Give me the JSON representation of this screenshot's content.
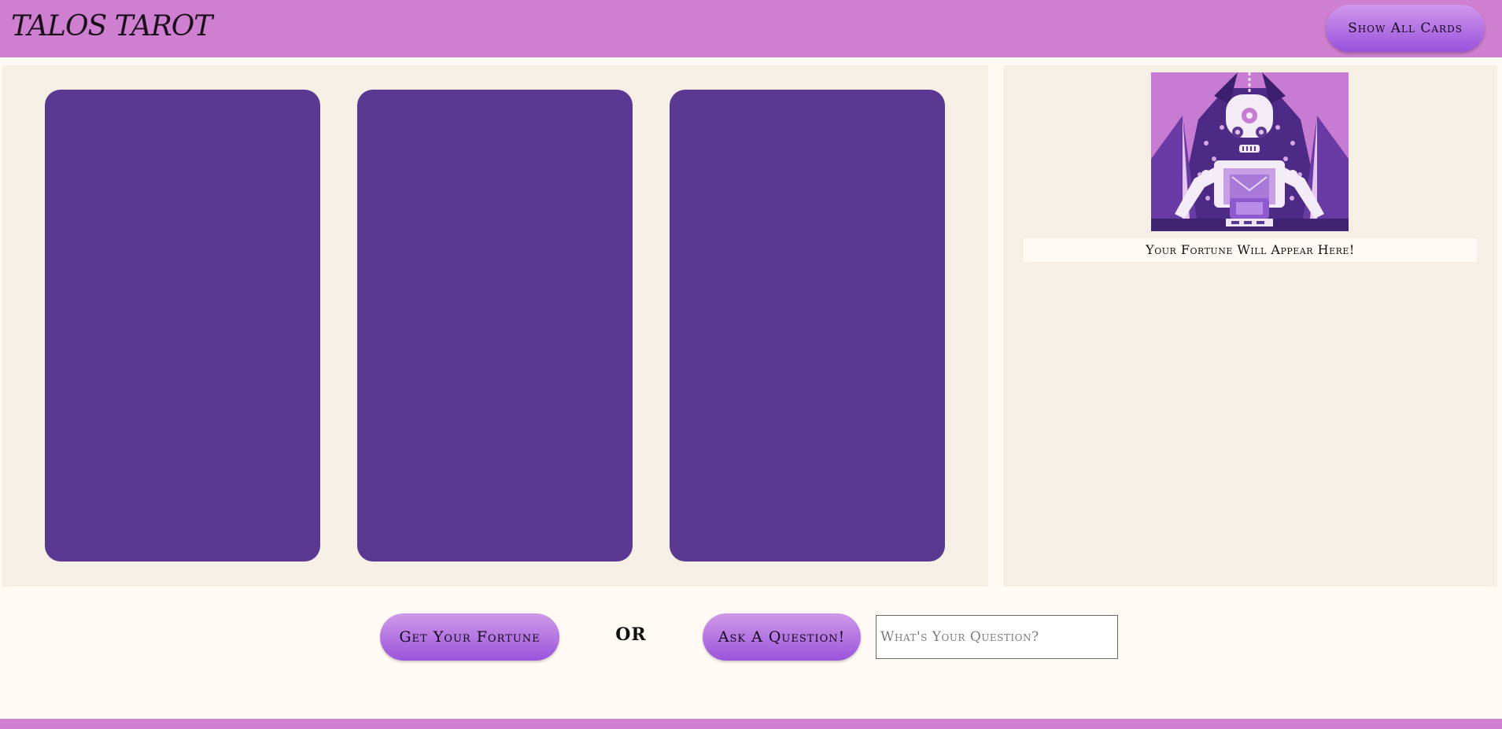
{
  "header": {
    "logo_part1": "TALOS",
    "logo_part2": "TAROT",
    "show_all_label": "Show All Cards"
  },
  "cards": [
    {
      "id": "card-1"
    },
    {
      "id": "card-2"
    },
    {
      "id": "card-3"
    }
  ],
  "reading": {
    "fortune_text": "Your Fortune Will Appear Here!"
  },
  "controls": {
    "get_fortune_label": "Get Your Fortune",
    "or_label": "OR",
    "ask_label": "Ask A Question!",
    "question_placeholder": "What's Your Question?",
    "question_value": ""
  },
  "colors": {
    "brand": "#ce7fcf",
    "card_back": "#5b3891",
    "panel_bg": "#f6efe6",
    "page_bg": "#fffaf3",
    "button_top": "#cf97ea",
    "button_bottom": "#9a52de"
  }
}
